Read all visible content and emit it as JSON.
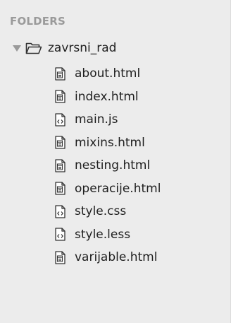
{
  "sidebar": {
    "header": "FOLDERS",
    "folder": {
      "name": "zavrsni_rad",
      "expanded": true,
      "icon": "folder-open-icon"
    },
    "files": [
      {
        "name": "about.html",
        "icon": "file-html-icon"
      },
      {
        "name": "index.html",
        "icon": "file-html-icon"
      },
      {
        "name": "main.js",
        "icon": "file-code-icon"
      },
      {
        "name": "mixins.html",
        "icon": "file-html-icon"
      },
      {
        "name": "nesting.html",
        "icon": "file-html-icon"
      },
      {
        "name": "operacije.html",
        "icon": "file-html-icon"
      },
      {
        "name": "style.css",
        "icon": "file-code-icon"
      },
      {
        "name": "style.less",
        "icon": "file-code-icon"
      },
      {
        "name": "varijable.html",
        "icon": "file-html-icon"
      }
    ]
  },
  "colors": {
    "panel_bg": "#ececec",
    "header_text": "#9a9a9a",
    "item_text": "#1f1f1f",
    "icon_stroke": "#333333"
  }
}
